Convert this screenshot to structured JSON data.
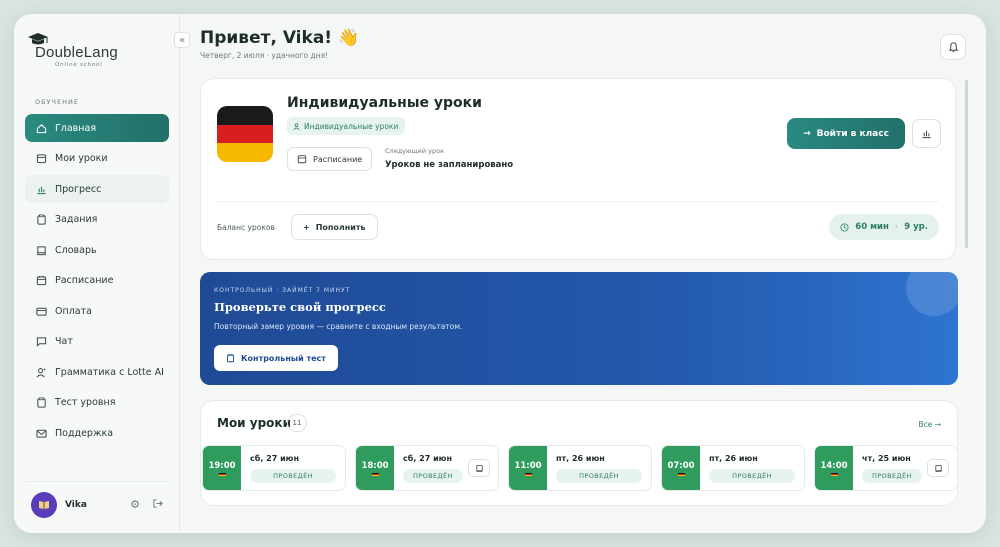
{
  "brand": {
    "name": "DoubleLang",
    "tagline": "Online school"
  },
  "sidebar": {
    "section_label": "ОБУЧЕНИЕ",
    "items": [
      {
        "label": "Главная",
        "icon": "home-icon"
      },
      {
        "label": "Мои уроки",
        "icon": "calendar-icon"
      },
      {
        "label": "Прогресс",
        "icon": "chart-icon"
      },
      {
        "label": "Задания",
        "icon": "clipboard-icon"
      },
      {
        "label": "Словарь",
        "icon": "book-icon"
      },
      {
        "label": "Расписание",
        "icon": "calendar-icon"
      },
      {
        "label": "Оплата",
        "icon": "card-icon"
      },
      {
        "label": "Чат",
        "icon": "chat-icon"
      },
      {
        "label": "Грамматика с Lotte AI",
        "icon": "user-star-icon"
      },
      {
        "label": "Тест уровня",
        "icon": "clipboard-icon"
      },
      {
        "label": "Поддержка",
        "icon": "mail-icon"
      }
    ],
    "user": {
      "name": "Vika"
    }
  },
  "header": {
    "greeting": "Привет, Vika! 👋",
    "subtitle": "Четверг, 2 июля · удачного дня!"
  },
  "lesson_card": {
    "title": "Индивидуальные уроки",
    "chip": "Индивидуальные уроки",
    "schedule_label": "Расписание",
    "next_label": "Следующий урок",
    "next_value": "Уроков не запланировано",
    "enter_label": "Войти в класс",
    "balance_label": "Баланс уроков",
    "topup_label": "Пополнить",
    "balance_minutes": "60 мин",
    "balance_lessons": "9 ур."
  },
  "promo": {
    "kicker": "КОНТРОЛЬНЫЙ · ЗАЙМЁТ 7 МИНУТ",
    "title": "Проверьте свой прогресс",
    "description": "Повторный замер уровня — сравните с входным результатом.",
    "button_label": "Контрольный тест"
  },
  "my_lessons": {
    "title": "Мои уроки",
    "count": "11",
    "all_label": "Все →",
    "items": [
      {
        "time": "19:00",
        "date": "сб, 27 июн",
        "status": "ПРОВЕДЁН",
        "has_book": false
      },
      {
        "time": "18:00",
        "date": "сб, 27 июн",
        "status": "ПРОВЕДЁН",
        "has_book": true
      },
      {
        "time": "11:00",
        "date": "пт, 26 июн",
        "status": "ПРОВЕДЁН",
        "has_book": false
      },
      {
        "time": "07:00",
        "date": "пт, 26 июн",
        "status": "ПРОВЕДЁН",
        "has_book": false
      },
      {
        "time": "14:00",
        "date": "чт, 25 июн",
        "status": "ПРОВЕДЁН",
        "has_book": true
      }
    ]
  },
  "colors": {
    "accent": "#2a8a80",
    "lesson_time": "#2f9b5d",
    "promo": "#2358ac",
    "flag_black": "#1a1a1a",
    "flag_red": "#d81e1e",
    "flag_gold": "#f6b800"
  }
}
